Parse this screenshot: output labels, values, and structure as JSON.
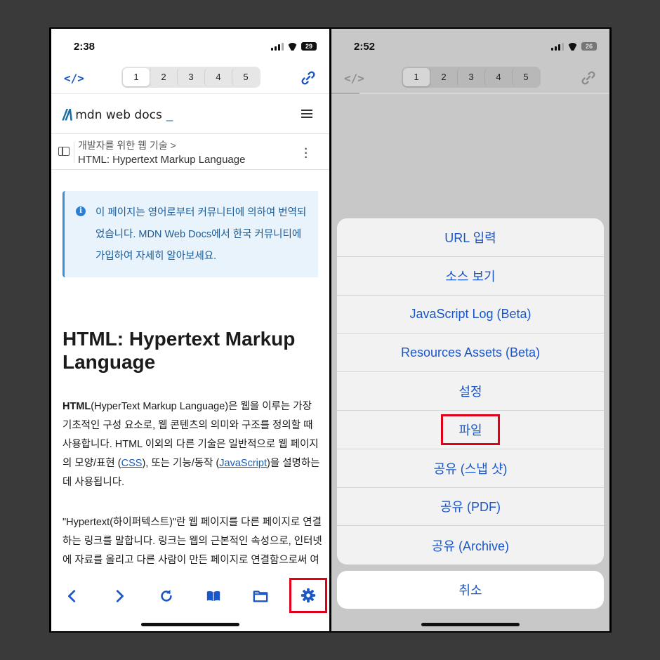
{
  "left": {
    "status": {
      "time": "2:38",
      "battery": "29"
    },
    "tabs": [
      "1",
      "2",
      "3",
      "4",
      "5"
    ],
    "mdn": {
      "logo_text": "mdn web docs",
      "logo_cursor": "_"
    },
    "breadcrumb": {
      "parent": "개발자를 위한 웹 기술  >",
      "current": "HTML: Hypertext Markup Language"
    },
    "notice": "이 페이지는 영어로부터 커뮤니티에 의하여 번역되었습니다. MDN Web Docs에서 한국 커뮤니티에 가입하여 자세히 알아보세요.",
    "title": "HTML: Hypertext Markup Language",
    "para1": {
      "bold": "HTML",
      "text1": "(HyperText Markup Language)은 웹을 이루는 가장 기초적인 구성 요소로, 웹 콘텐츠의 의미와 구조를 정의할 때 사용합니다. HTML 이외의 다른 기술은 일반적으로 웹 페이지의 모양/표현 (",
      "link1": "CSS",
      "text2": "), 또는 기능/동작 (",
      "link2": "JavaScript",
      "text3": ")을 설명하는 데 사용됩니다."
    },
    "para2": "\"Hypertext(하이퍼텍스트)\"란 웹 페이지를 다른 페이지로 연결하는 링크를 말합니다. 링크는 웹의 근본적인 속성으로, 인터넷에 자료를 올리고 다른 사람이 만든 페이지로 연결함으로써 여러분도 월드 와이드 웹 세계에서 능동적인 참여자가 될 수 있습니다."
  },
  "right": {
    "status": {
      "time": "2:52",
      "battery": "26"
    },
    "tabs": [
      "1",
      "2",
      "3",
      "4",
      "5"
    ],
    "menu": [
      "URL 입력",
      "소스 보기",
      "JavaScript Log (Beta)",
      "Resources Assets (Beta)",
      "설정",
      "파일",
      "공유 (스냅 샷)",
      "공유 (PDF)",
      "공유 (Archive)"
    ],
    "cancel": "취소"
  },
  "colors": {
    "accent": "#1a56c7",
    "highlight": "#e1001a",
    "mdn_blue": "#1b6fa5"
  }
}
